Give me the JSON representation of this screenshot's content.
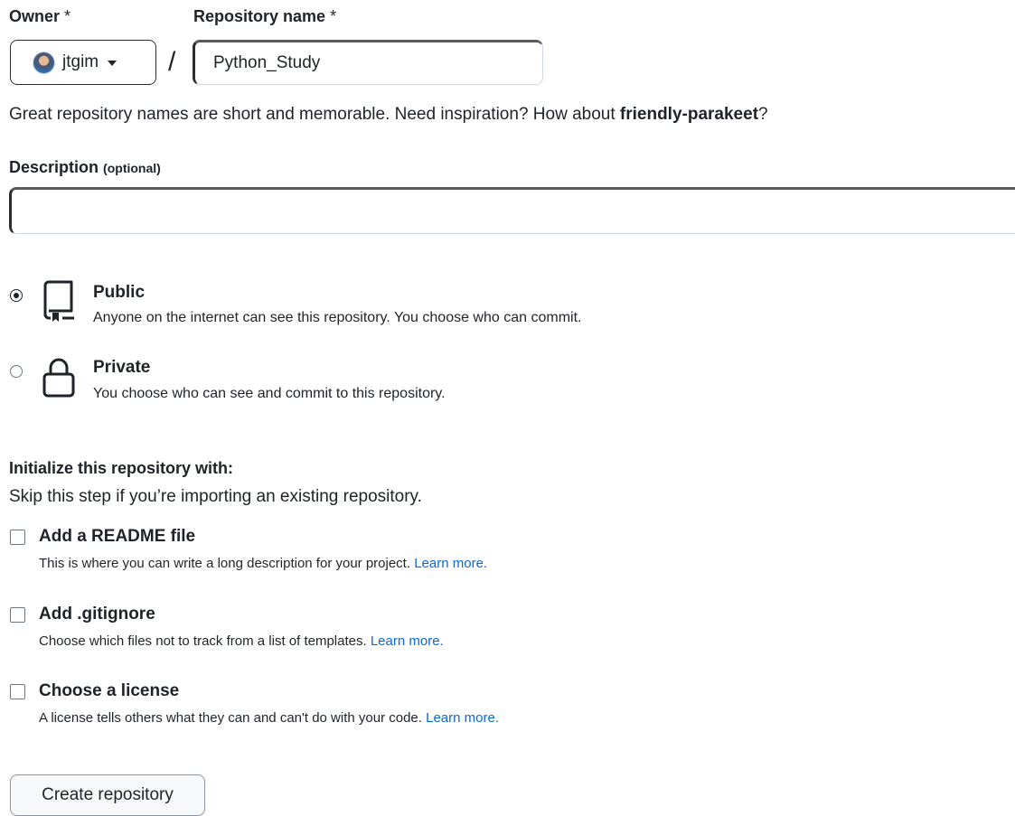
{
  "owner": {
    "label": "Owner",
    "required_mark": "*",
    "name": "jtgim"
  },
  "repo": {
    "label": "Repository name",
    "required_mark": "*",
    "separator": "/",
    "value": "Python_Study"
  },
  "hint": {
    "text": "Great repository names are short and memorable. Need inspiration? How about ",
    "suggestion": "friendly-parakeet",
    "end": "?"
  },
  "description": {
    "label": "Description",
    "optional": "(optional)",
    "value": ""
  },
  "visibility": {
    "selected": "public",
    "options": [
      {
        "id": "public",
        "title": "Public",
        "desc": "Anyone on the internet can see this repository. You choose who can commit.",
        "icon": "repo-icon"
      },
      {
        "id": "private",
        "title": "Private",
        "desc": "You choose who can see and commit to this repository.",
        "icon": "lock-icon"
      }
    ]
  },
  "init": {
    "title": "Initialize this repository with:",
    "subtitle": "Skip this step if you’re importing an existing repository.",
    "options": [
      {
        "title": "Add a README file",
        "desc": "This is where you can write a long description for your project.",
        "link": "Learn more.",
        "checked": false
      },
      {
        "title": "Add .gitignore",
        "desc": "Choose which files not to track from a list of templates.",
        "link": "Learn more.",
        "checked": false
      },
      {
        "title": "Choose a license",
        "desc": "A license tells others what they can and can't do with your code.",
        "link": "Learn more.",
        "checked": false
      }
    ]
  },
  "submit": {
    "label": "Create repository"
  },
  "colors": {
    "link": "#0969da",
    "text": "#1f2328",
    "border": "#d0d7de"
  }
}
